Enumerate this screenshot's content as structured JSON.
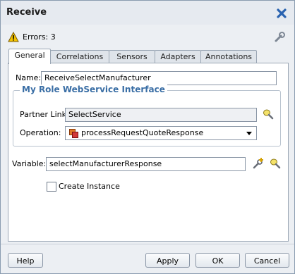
{
  "window": {
    "title": "Receive"
  },
  "errors": {
    "text": "Errors: 3"
  },
  "tabs": [
    "General",
    "Correlations",
    "Sensors",
    "Adapters",
    "Annotations"
  ],
  "general": {
    "name_label": "Name:",
    "name_value": "ReceiveSelectManufacturer",
    "group_title": "My Role WebService Interface",
    "partner_link_label": "Partner Link:",
    "partner_link_value": "SelectService",
    "operation_label": "Operation:",
    "operation_value": "processRequestQuoteResponse",
    "variable_label": "Variable:",
    "variable_value": "selectManufacturerResponse",
    "create_instance_label": "Create Instance",
    "create_instance_checked": false
  },
  "buttons": {
    "help": "Help",
    "apply": "Apply",
    "ok": "OK",
    "cancel": "Cancel"
  }
}
